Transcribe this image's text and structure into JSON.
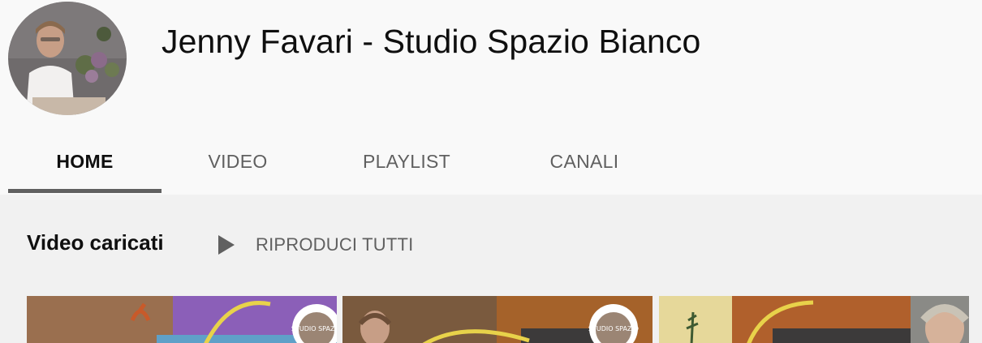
{
  "channel": {
    "name": "Jenny Favari - Studio Spazio Bianco"
  },
  "tabs": [
    {
      "label": "HOME",
      "active": true
    },
    {
      "label": "VIDEO",
      "active": false
    },
    {
      "label": "PLAYLIST",
      "active": false
    },
    {
      "label": "CANALI",
      "active": false
    }
  ],
  "uploads": {
    "title": "Video caricati",
    "play_all_label": "RIPRODUCI TUTTI"
  },
  "thumbnails": [
    {
      "logo_text": "STUDIO SPAZIO"
    },
    {
      "logo_text": "STUDIO SPAZIO"
    },
    {
      "logo_text": ""
    }
  ],
  "colors": {
    "header_bg": "#f9f9f9",
    "section_bg": "#f1f1f1",
    "tab_active": "#0f0f0f",
    "tab_inactive": "#606060",
    "underline": "#606060"
  }
}
